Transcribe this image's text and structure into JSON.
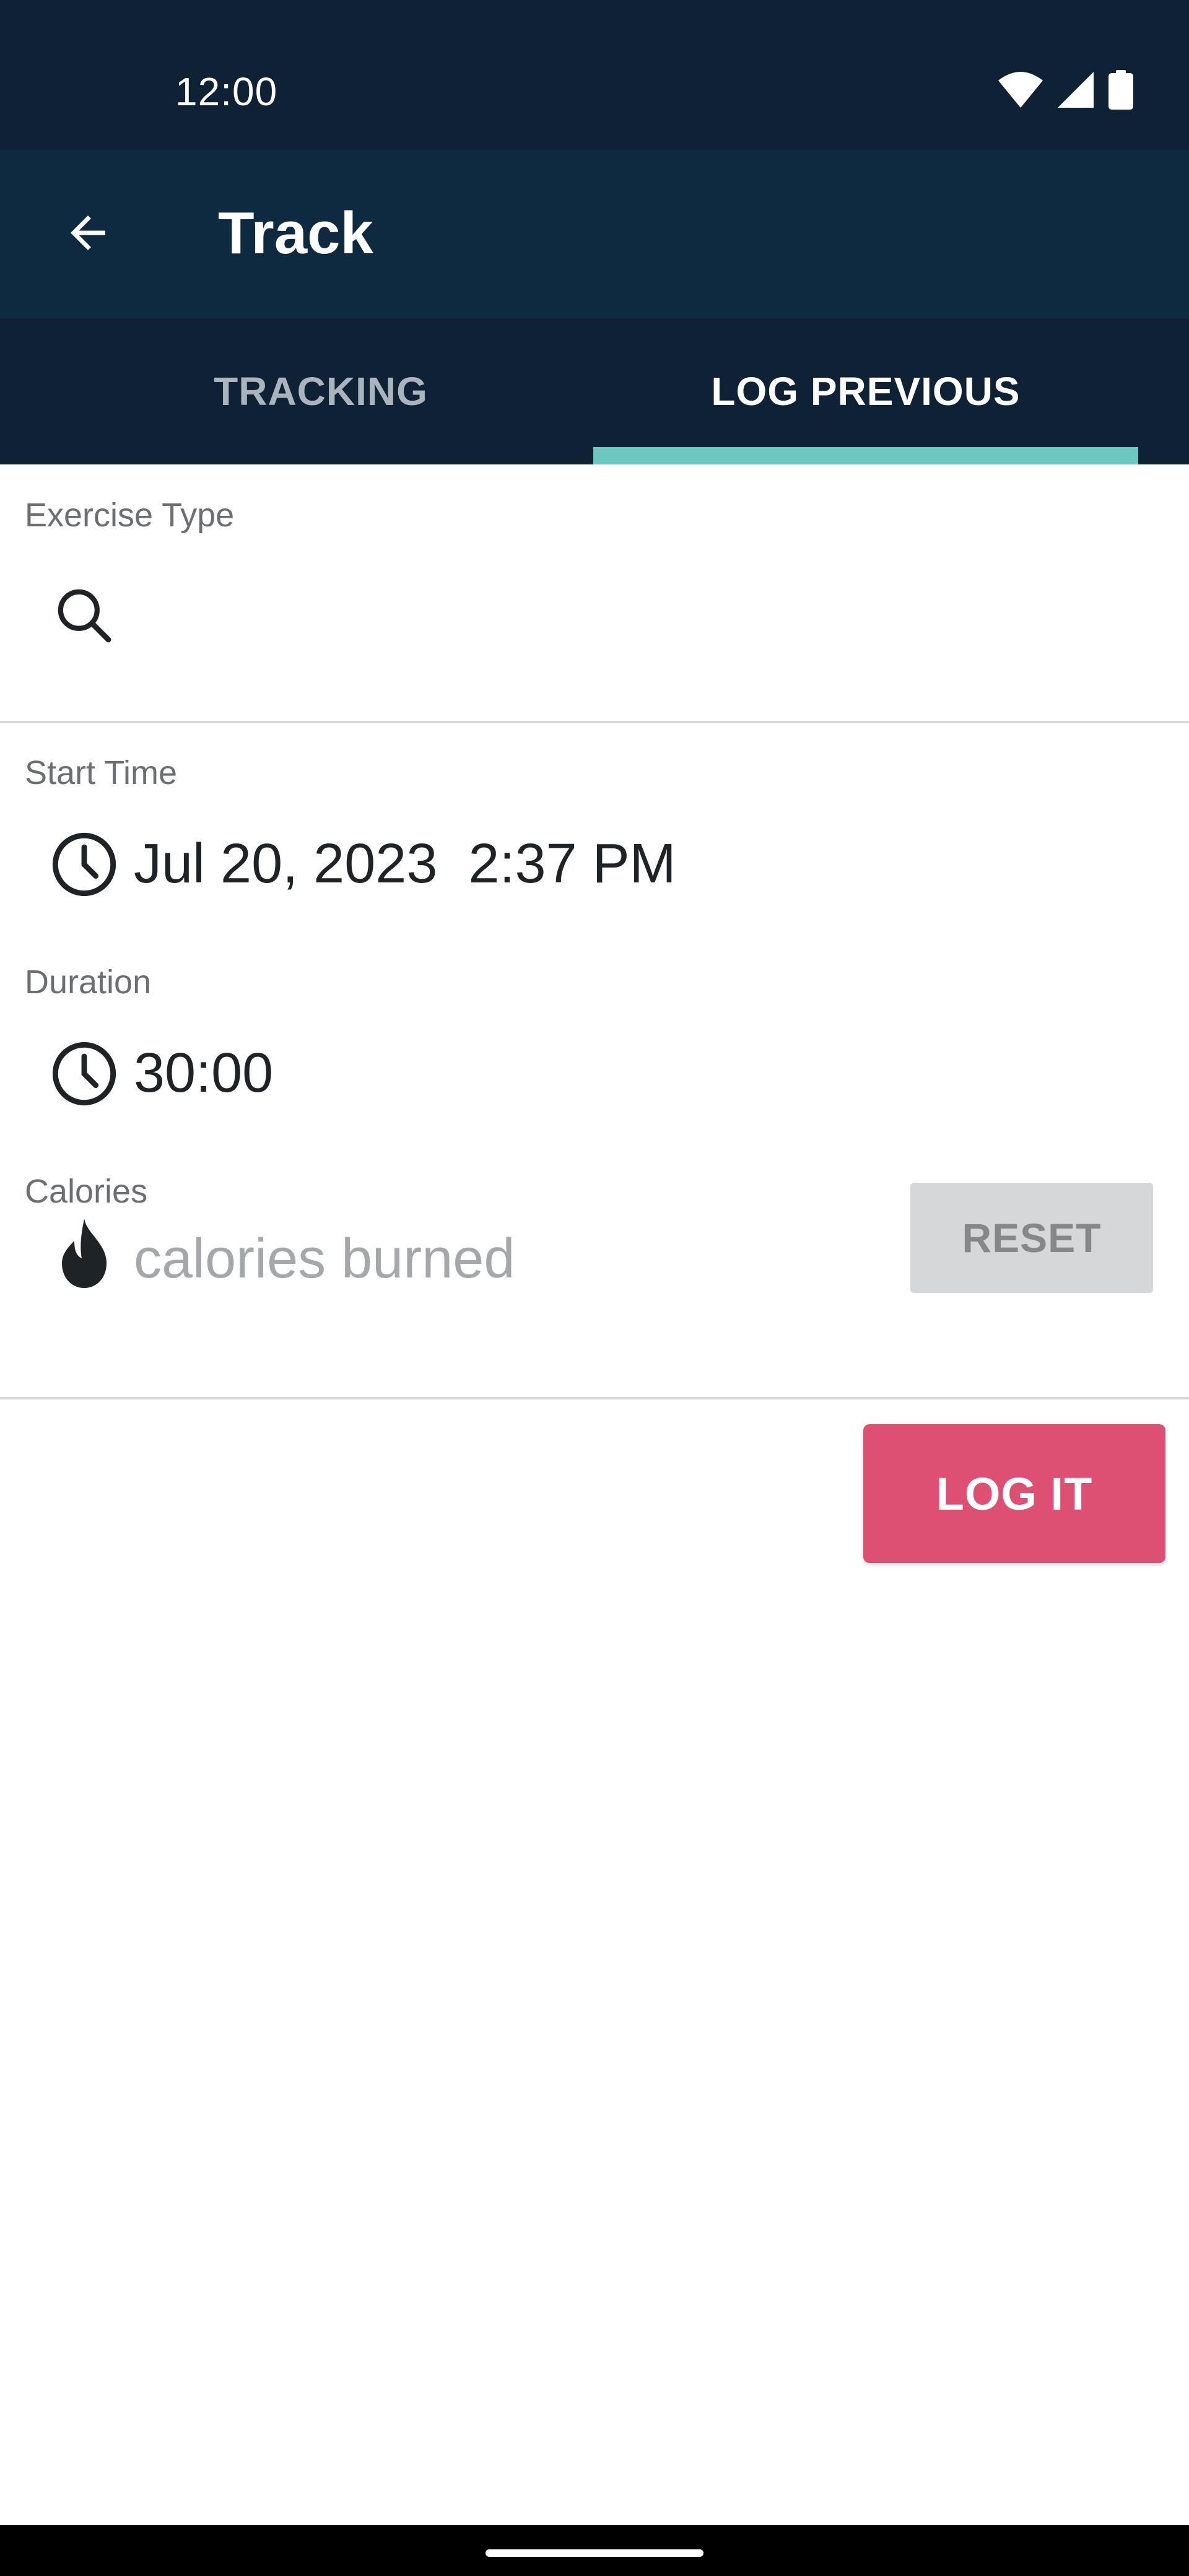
{
  "status_bar": {
    "time": "12:00",
    "icons": [
      "wifi-icon",
      "signal-icon",
      "battery-icon"
    ]
  },
  "app_bar": {
    "back_icon": "arrow-left-icon",
    "title": "Track"
  },
  "tabs": [
    {
      "label": "TRACKING",
      "selected": false
    },
    {
      "label": "LOG PREVIOUS",
      "selected": true
    }
  ],
  "form": {
    "exercise_type": {
      "label": "Exercise Type",
      "icon": "search-icon",
      "value": ""
    },
    "start_time": {
      "label": "Start Time",
      "icon": "clock-icon",
      "date": "Jul 20, 2023",
      "time": "2:37 PM"
    },
    "duration": {
      "label": "Duration",
      "icon": "clock-icon",
      "value": "30:00"
    },
    "calories": {
      "label": "Calories",
      "icon": "flame-icon",
      "placeholder": "calories burned",
      "reset_label": "RESET"
    }
  },
  "actions": {
    "log_label": "LOG IT"
  },
  "colors": {
    "status_bg": "#0f2134",
    "app_bar_bg": "#0e2a41",
    "tab_indicator": "#6cc7c1",
    "log_button": "#de5073",
    "reset_button": "#d6d7d8"
  }
}
